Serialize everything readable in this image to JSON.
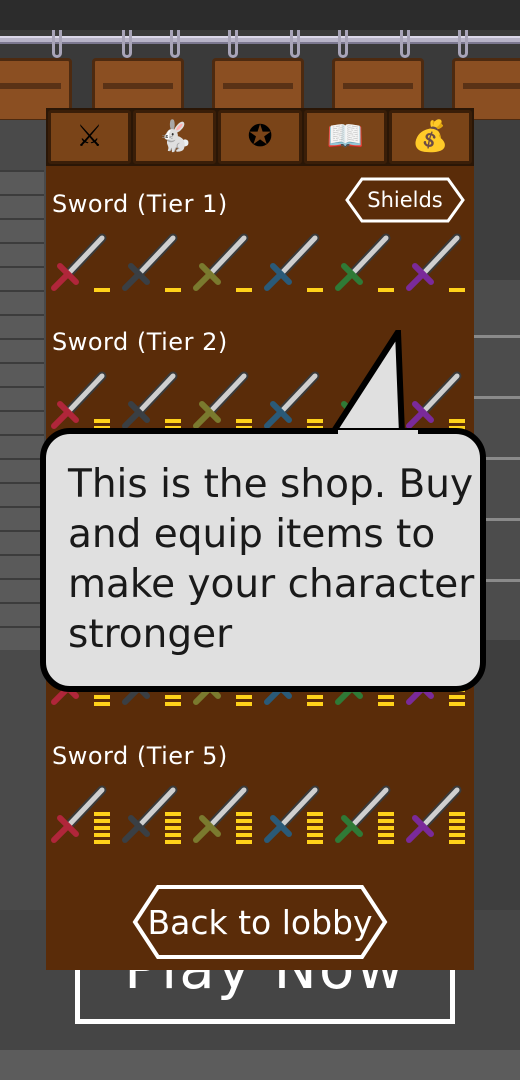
{
  "tabs": [
    {
      "name": "shield-sword-icon",
      "glyph": "⚔"
    },
    {
      "name": "helmet-icon",
      "glyph": "🐇"
    },
    {
      "name": "pentagram-icon",
      "glyph": "✪"
    },
    {
      "name": "spellbook-icon",
      "glyph": "📖"
    },
    {
      "name": "money-coin-icon",
      "glyph": "💰"
    }
  ],
  "shop": {
    "shields_label": "Shields",
    "back_label": "Back to lobby",
    "tiers": [
      {
        "label": "Sword (Tier 1)",
        "level": 1
      },
      {
        "label": "Sword (Tier 2)",
        "level": 2
      },
      {
        "label": "",
        "level": 4
      },
      {
        "label": "",
        "level": 4
      },
      {
        "label": "Sword (Tier 5)",
        "level": 5
      }
    ],
    "sword_hilt_colors": [
      "#b0263a",
      "#3a3f44",
      "#7a7a2e",
      "#2a5a78",
      "#2f7a36",
      "#7a2a9a"
    ]
  },
  "tutorial": {
    "message": "This is the shop. Buy and equip items to make your character stronger"
  },
  "background": {
    "play_label": "Play Now"
  },
  "colors": {
    "panel": "#5a2c09",
    "bar": "#ffd21a",
    "bubble": "#e0e0e0"
  }
}
